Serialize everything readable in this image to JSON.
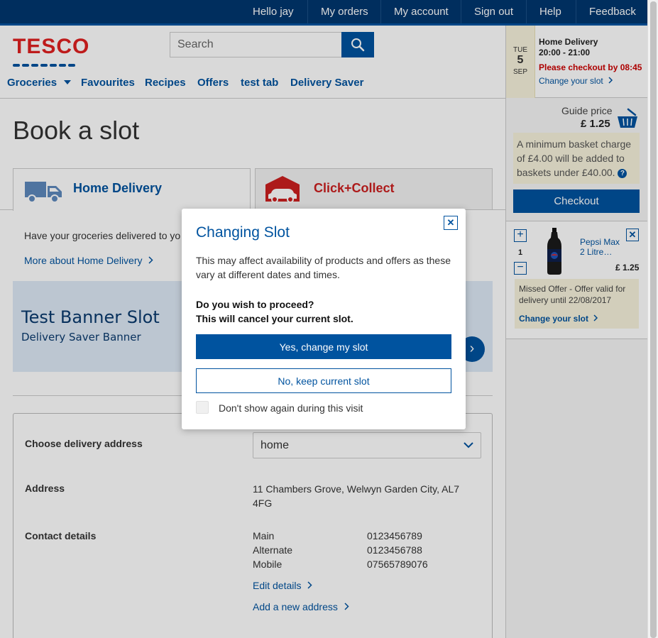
{
  "topbar": {
    "hello": "Hello jay",
    "orders": "My orders",
    "account": "My account",
    "signout": "Sign out",
    "help": "Help",
    "feedback": "Feedback"
  },
  "header": {
    "logo": "TESCO",
    "search_placeholder": "Search"
  },
  "nav": {
    "groceries": "Groceries",
    "favourites": "Favourites",
    "recipes": "Recipes",
    "offers": "Offers",
    "test_tab": "test tab",
    "delivery_saver": "Delivery Saver"
  },
  "slot": {
    "dow": "TUE",
    "day": "5",
    "month": "SEP",
    "title": "Home Delivery",
    "time": "20:00 - 21:00",
    "warning": "Please checkout by 08:45",
    "change": "Change your slot"
  },
  "basket": {
    "guide_label": "Guide price",
    "guide_price": "£ 1.25",
    "min_charge": "A minimum basket charge of £4.00 will be added to baskets under £40.00.",
    "help": "?",
    "checkout": "Checkout",
    "item": {
      "qty_plus": "+",
      "qty": "1",
      "qty_minus": "−",
      "name": "Pepsi Max 2 Litre…",
      "remove": "✕",
      "price": "£ 1.25",
      "missed": "Missed Offer - Offer valid for delivery until 22/08/2017",
      "change": "Change your slot"
    }
  },
  "main": {
    "title": "Book a slot",
    "tab_home": "Home Delivery",
    "tab_cc": "Click+Collect",
    "intro": "Have your groceries delivered to yo",
    "more": "More about Home Delivery",
    "banner_title": "Test Banner Slot",
    "banner_sub": "Delivery Saver Banner"
  },
  "details": {
    "choose_label": "Choose delivery address",
    "address_value": "home",
    "address_label": "Address",
    "address_line1": "11 Chambers Grove, Welwyn Garden City, AL7",
    "address_line2": "4FG",
    "contact_label": "Contact details",
    "contacts": [
      {
        "type": "Main",
        "number": "0123456789"
      },
      {
        "type": "Alternate",
        "number": "0123456788"
      },
      {
        "type": "Mobile",
        "number": "07565789076"
      }
    ],
    "edit": "Edit details",
    "add": "Add a new address"
  },
  "modal": {
    "title": "Changing Slot",
    "close": "✕",
    "body": "This may affect availability of products and offers as these vary at different dates and times.",
    "question1": "Do you wish to proceed?",
    "question2": "This will cancel your current slot.",
    "yes": "Yes, change my slot",
    "no": "No, keep current slot",
    "checkbox": "Don't show again during this visit"
  },
  "colors": {
    "brand_blue": "#00539f",
    "topbar": "#00376f",
    "tesco_red": "#e02020",
    "warning": "#cc0000",
    "note_bg": "#f7f3dc"
  }
}
